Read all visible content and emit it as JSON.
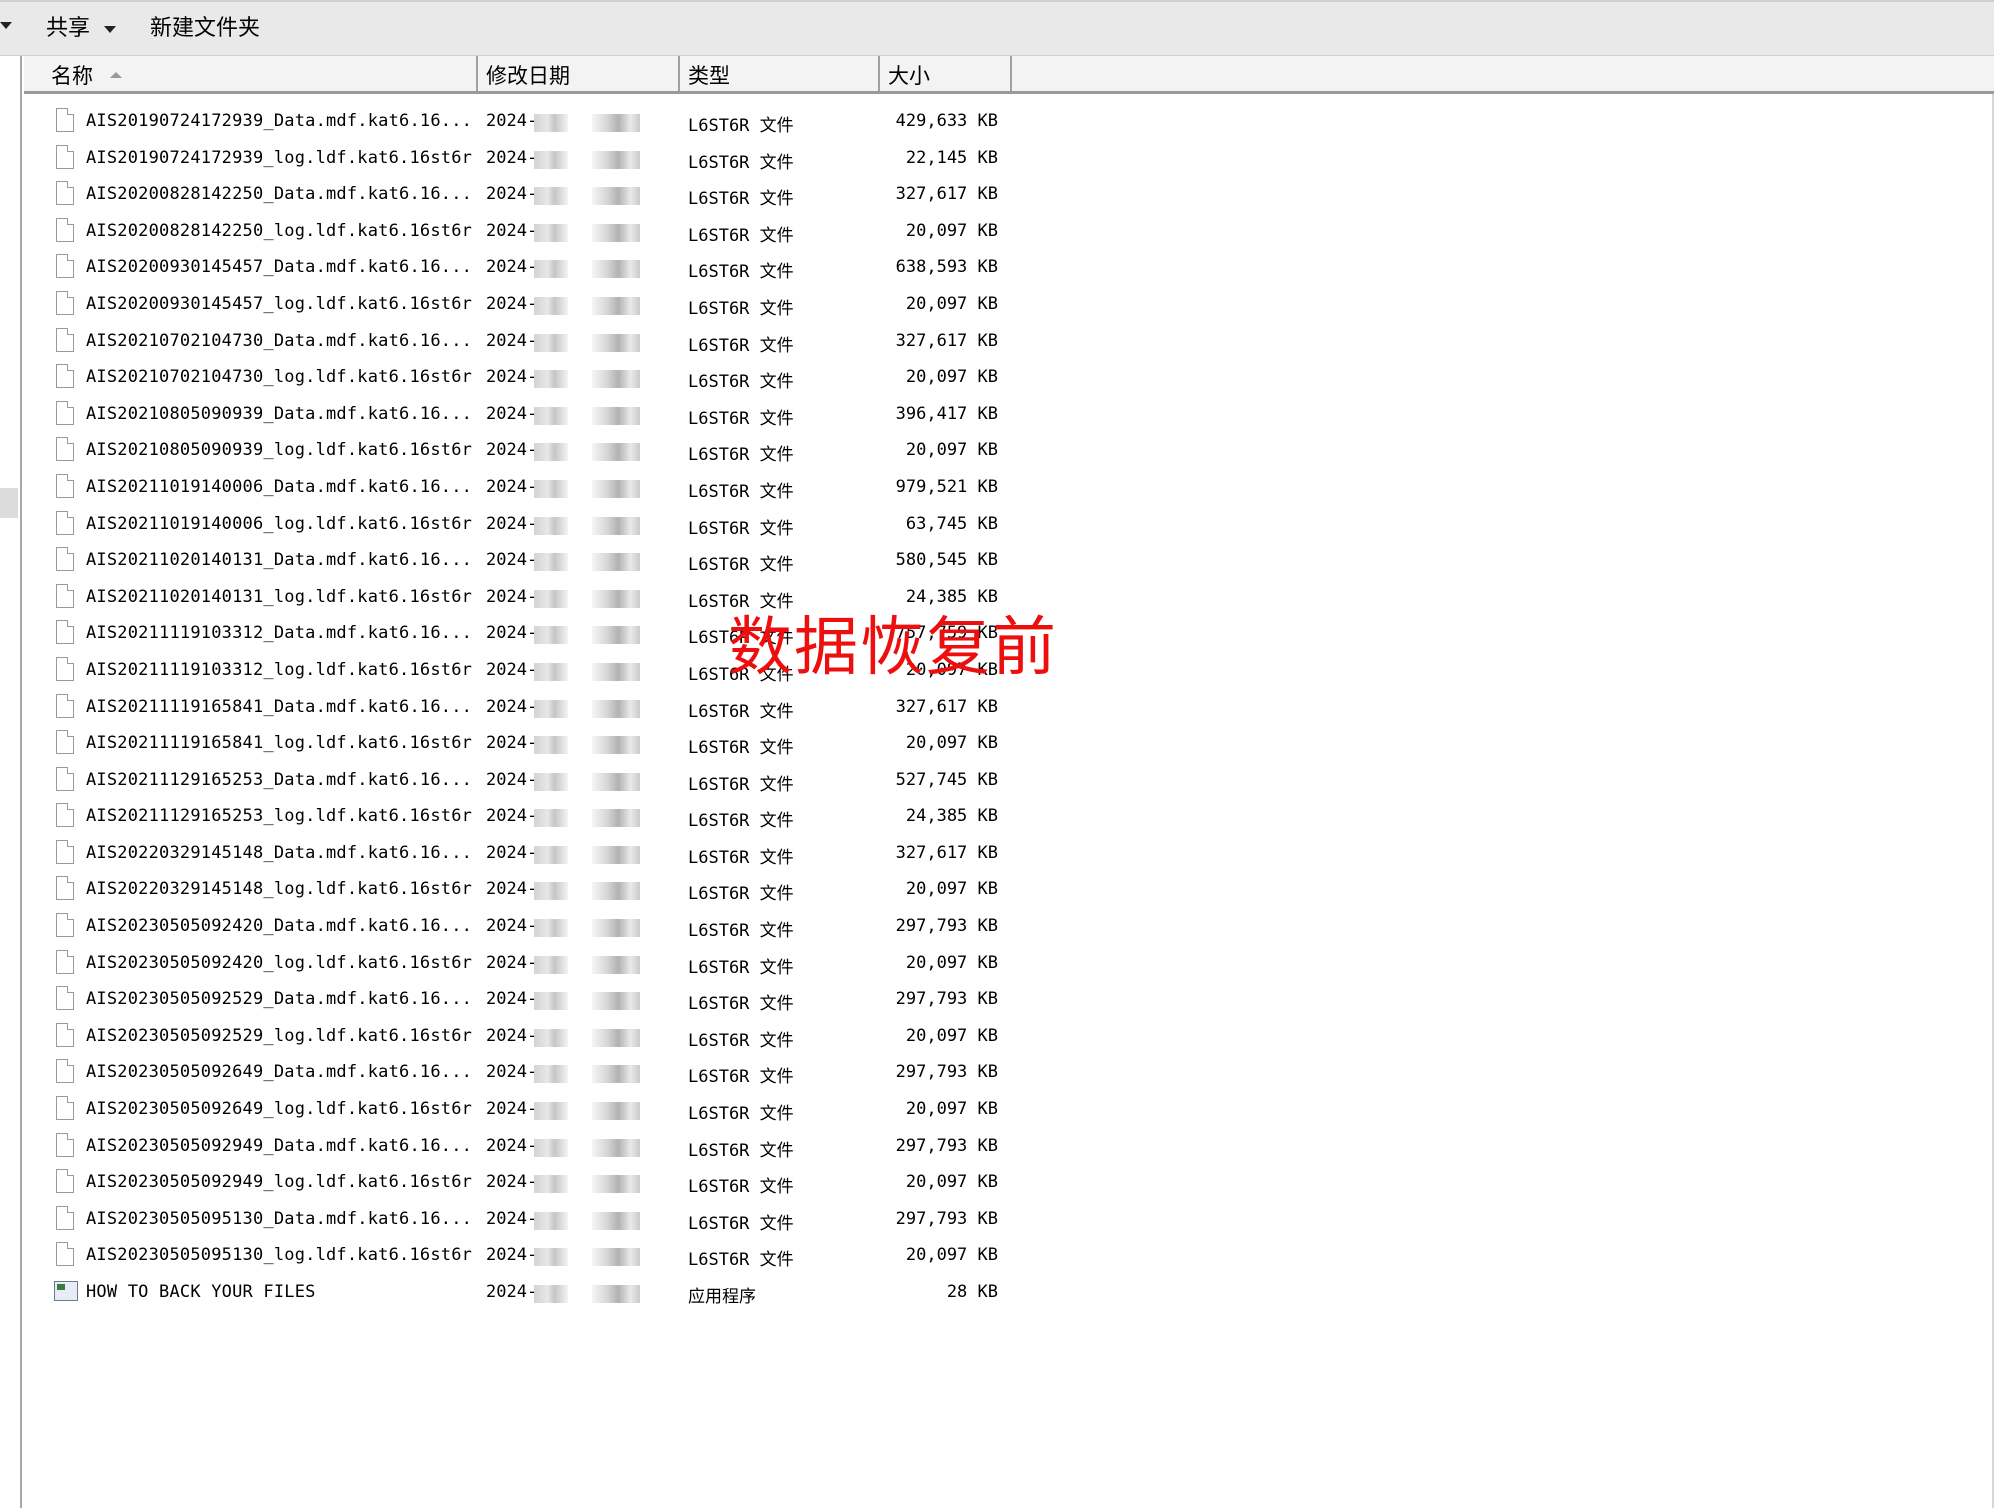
{
  "toolbar": {
    "share_label": "共享",
    "new_folder_label": "新建文件夹"
  },
  "columns": {
    "name": "名称",
    "date": "修改日期",
    "type": "类型",
    "size": "大小"
  },
  "files": [
    {
      "name": "AIS20190724172939_Data.mdf.kat6.16...",
      "date": "2024-",
      "type": "L6ST6R 文件",
      "size": "429,633 KB"
    },
    {
      "name": "AIS20190724172939_log.ldf.kat6.16st6r",
      "date": "2024-",
      "type": "L6ST6R 文件",
      "size": "22,145 KB"
    },
    {
      "name": "AIS20200828142250_Data.mdf.kat6.16...",
      "date": "2024-",
      "type": "L6ST6R 文件",
      "size": "327,617 KB"
    },
    {
      "name": "AIS20200828142250_log.ldf.kat6.16st6r",
      "date": "2024-",
      "type": "L6ST6R 文件",
      "size": "20,097 KB"
    },
    {
      "name": "AIS20200930145457_Data.mdf.kat6.16...",
      "date": "2024-",
      "type": "L6ST6R 文件",
      "size": "638,593 KB"
    },
    {
      "name": "AIS20200930145457_log.ldf.kat6.16st6r",
      "date": "2024-",
      "type": "L6ST6R 文件",
      "size": "20,097 KB"
    },
    {
      "name": "AIS20210702104730_Data.mdf.kat6.16...",
      "date": "2024-",
      "type": "L6ST6R 文件",
      "size": "327,617 KB"
    },
    {
      "name": "AIS20210702104730_log.ldf.kat6.16st6r",
      "date": "2024-",
      "type": "L6ST6R 文件",
      "size": "20,097 KB"
    },
    {
      "name": "AIS20210805090939_Data.mdf.kat6.16...",
      "date": "2024-",
      "type": "L6ST6R 文件",
      "size": "396,417 KB"
    },
    {
      "name": "AIS20210805090939_log.ldf.kat6.16st6r",
      "date": "2024-",
      "type": "L6ST6R 文件",
      "size": "20,097 KB"
    },
    {
      "name": "AIS20211019140006_Data.mdf.kat6.16...",
      "date": "2024-",
      "type": "L6ST6R 文件",
      "size": "979,521 KB"
    },
    {
      "name": "AIS20211019140006_log.ldf.kat6.16st6r",
      "date": "2024-",
      "type": "L6ST6R 文件",
      "size": "63,745 KB"
    },
    {
      "name": "AIS20211020140131_Data.mdf.kat6.16...",
      "date": "2024-",
      "type": "L6ST6R 文件",
      "size": "580,545 KB"
    },
    {
      "name": "AIS20211020140131_log.ldf.kat6.16st6r",
      "date": "2024-",
      "type": "L6ST6R 文件",
      "size": "24,385 KB"
    },
    {
      "name": "AIS20211119103312_Data.mdf.kat6.16...",
      "date": "2024-",
      "type": "L6ST6R 文件",
      "size": "757,759 KB"
    },
    {
      "name": "AIS20211119103312_log.ldf.kat6.16st6r",
      "date": "2024-",
      "type": "L6ST6R 文件",
      "size": "20,097 KB"
    },
    {
      "name": "AIS20211119165841_Data.mdf.kat6.16...",
      "date": "2024-",
      "type": "L6ST6R 文件",
      "size": "327,617 KB"
    },
    {
      "name": "AIS20211119165841_log.ldf.kat6.16st6r",
      "date": "2024-",
      "type": "L6ST6R 文件",
      "size": "20,097 KB"
    },
    {
      "name": "AIS20211129165253_Data.mdf.kat6.16...",
      "date": "2024-",
      "type": "L6ST6R 文件",
      "size": "527,745 KB"
    },
    {
      "name": "AIS20211129165253_log.ldf.kat6.16st6r",
      "date": "2024-",
      "type": "L6ST6R 文件",
      "size": "24,385 KB"
    },
    {
      "name": "AIS20220329145148_Data.mdf.kat6.16...",
      "date": "2024-",
      "type": "L6ST6R 文件",
      "size": "327,617 KB"
    },
    {
      "name": "AIS20220329145148_log.ldf.kat6.16st6r",
      "date": "2024-",
      "type": "L6ST6R 文件",
      "size": "20,097 KB"
    },
    {
      "name": "AIS20230505092420_Data.mdf.kat6.16...",
      "date": "2024-",
      "type": "L6ST6R 文件",
      "size": "297,793 KB"
    },
    {
      "name": "AIS20230505092420_log.ldf.kat6.16st6r",
      "date": "2024-",
      "type": "L6ST6R 文件",
      "size": "20,097 KB"
    },
    {
      "name": "AIS20230505092529_Data.mdf.kat6.16...",
      "date": "2024-",
      "type": "L6ST6R 文件",
      "size": "297,793 KB"
    },
    {
      "name": "AIS20230505092529_log.ldf.kat6.16st6r",
      "date": "2024-",
      "type": "L6ST6R 文件",
      "size": "20,097 KB"
    },
    {
      "name": "AIS20230505092649_Data.mdf.kat6.16...",
      "date": "2024-",
      "type": "L6ST6R 文件",
      "size": "297,793 KB"
    },
    {
      "name": "AIS20230505092649_log.ldf.kat6.16st6r",
      "date": "2024-",
      "type": "L6ST6R 文件",
      "size": "20,097 KB"
    },
    {
      "name": "AIS20230505092949_Data.mdf.kat6.16...",
      "date": "2024-",
      "type": "L6ST6R 文件",
      "size": "297,793 KB"
    },
    {
      "name": "AIS20230505092949_log.ldf.kat6.16st6r",
      "date": "2024-",
      "type": "L6ST6R 文件",
      "size": "20,097 KB"
    },
    {
      "name": "AIS20230505095130_Data.mdf.kat6.16...",
      "date": "2024-",
      "type": "L6ST6R 文件",
      "size": "297,793 KB"
    },
    {
      "name": "AIS20230505095130_log.ldf.kat6.16st6r",
      "date": "2024-",
      "type": "L6ST6R 文件",
      "size": "20,097 KB"
    },
    {
      "name": "HOW TO BACK YOUR FILES",
      "date": "2024-",
      "type": "应用程序",
      "size": "28 KB",
      "icon": "app-icon"
    }
  ],
  "watermark": "数据恢复前"
}
